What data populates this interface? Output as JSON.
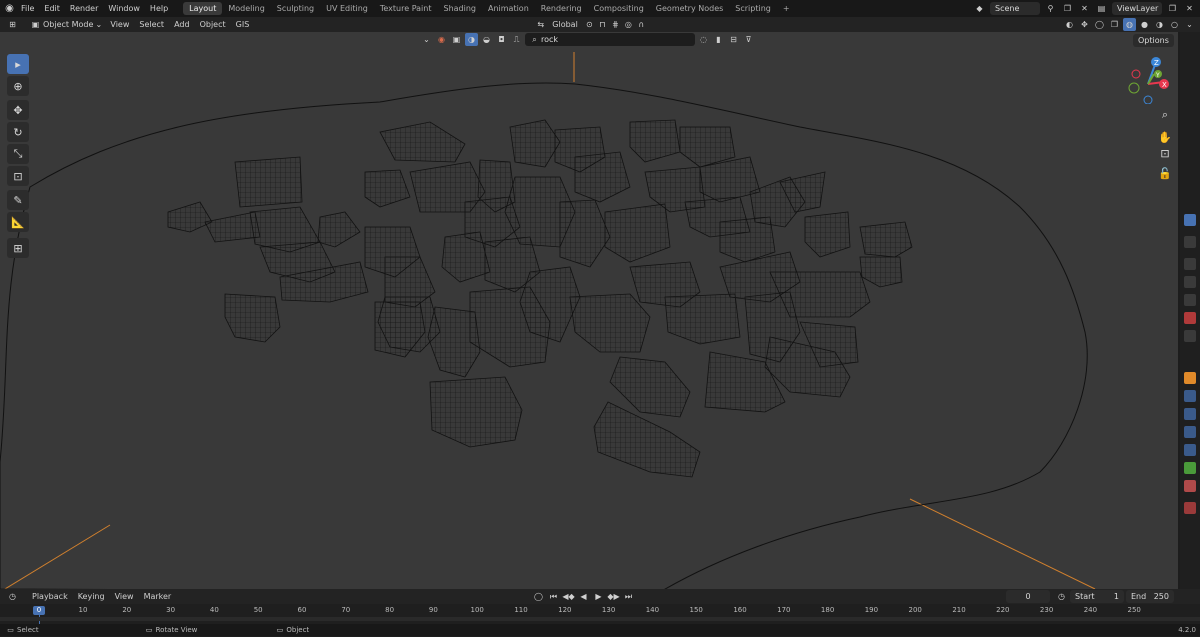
{
  "topbar": {
    "menus": [
      "File",
      "Edit",
      "Render",
      "Window",
      "Help"
    ],
    "workspaces": [
      "Layout",
      "Modeling",
      "Sculpting",
      "UV Editing",
      "Texture Paint",
      "Shading",
      "Animation",
      "Rendering",
      "Compositing",
      "Geometry Nodes",
      "Scripting"
    ],
    "active_workspace": "Layout",
    "add_workspace": "+",
    "scene": "Scene",
    "view_layer": "ViewLayer"
  },
  "header": {
    "mode": "Object Mode",
    "menus": [
      "View",
      "Select",
      "Add",
      "Object",
      "GIS"
    ],
    "orientation": "Global",
    "search_value": "rock",
    "options_label": "Options"
  },
  "gizmo": {
    "x": "X",
    "y": "Y",
    "z": "Z"
  },
  "timeline": {
    "menus": [
      "Playback",
      "Keying",
      "View",
      "Marker"
    ],
    "current_frame": "0",
    "start_label": "Start",
    "start_value": "1",
    "end_label": "End",
    "end_value": "250",
    "playhead": "0",
    "ticks": [
      "10",
      "20",
      "30",
      "40",
      "50",
      "60",
      "70",
      "80",
      "90",
      "100",
      "110",
      "120",
      "130",
      "140",
      "150",
      "160",
      "170",
      "180",
      "190",
      "200",
      "210",
      "220",
      "230",
      "240",
      "250"
    ]
  },
  "status": {
    "select": "Select",
    "rotate": "Rotate View",
    "object": "Object",
    "version": "4.2.0"
  },
  "colors": {
    "accent": "#4772b3",
    "axis_x": "#e8374e",
    "axis_y": "#6ea534",
    "axis_z": "#3c87d8",
    "axis_line": "#d1802e",
    "wire": "#161616"
  },
  "icons": [
    "blender-icon",
    "select-box-icon",
    "cursor-icon",
    "move-icon",
    "rotate-icon",
    "scale-icon",
    "transform-icon",
    "annotate-icon",
    "measure-icon",
    "add-cube-icon",
    "zoom-icon",
    "hand-icon",
    "camera-icon",
    "lock-icon",
    "filter-icon",
    "search-icon",
    "play-icon"
  ]
}
